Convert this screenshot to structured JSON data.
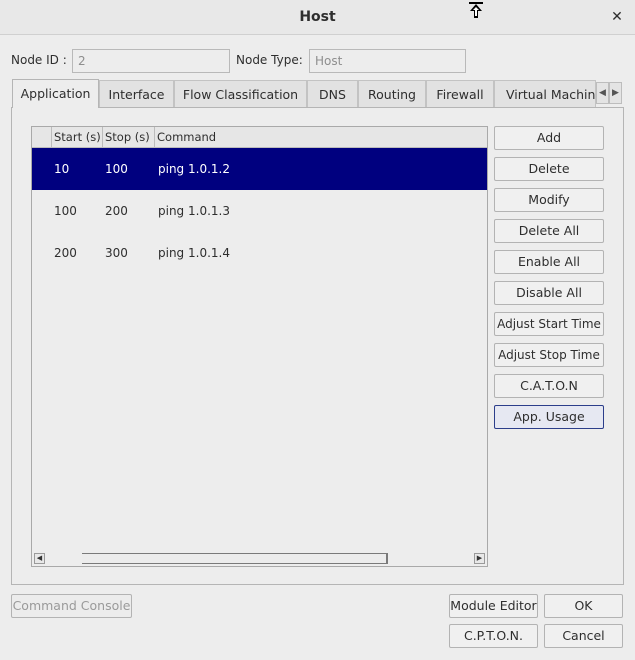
{
  "window": {
    "title": "Host",
    "close_glyph": "✕"
  },
  "node": {
    "id_label": "Node ID :",
    "id_value": "2",
    "type_label": "Node Type:",
    "type_value": "Host"
  },
  "tabs": [
    {
      "label": "Application",
      "active": true
    },
    {
      "label": "Interface"
    },
    {
      "label": "Flow Classification"
    },
    {
      "label": "DNS"
    },
    {
      "label": "Routing"
    },
    {
      "label": "Firewall"
    },
    {
      "label": "Virtual Machine"
    }
  ],
  "table": {
    "columns": [
      "Start (s)",
      "Stop (s)",
      "Command"
    ],
    "rows": [
      {
        "start": "10",
        "stop": "100",
        "command": "ping 1.0.1.2",
        "selected": true
      },
      {
        "start": "100",
        "stop": "200",
        "command": "ping 1.0.1.3"
      },
      {
        "start": "200",
        "stop": "300",
        "command": "ping 1.0.1.4"
      }
    ]
  },
  "side_buttons": {
    "add": "Add",
    "delete": "Delete",
    "modify": "Modify",
    "delete_all": "Delete All",
    "enable_all": "Enable All",
    "disable_all": "Disable All",
    "adjust_start": "Adjust Start Time",
    "adjust_stop": "Adjust Stop Time",
    "caton": "C.A.T.O.N",
    "app_usage": "App. Usage"
  },
  "footer": {
    "command_console": "Command Console",
    "module_editor": "Module Editor",
    "ok": "OK",
    "cpton": "C.P.T.O.N.",
    "cancel": "Cancel"
  }
}
